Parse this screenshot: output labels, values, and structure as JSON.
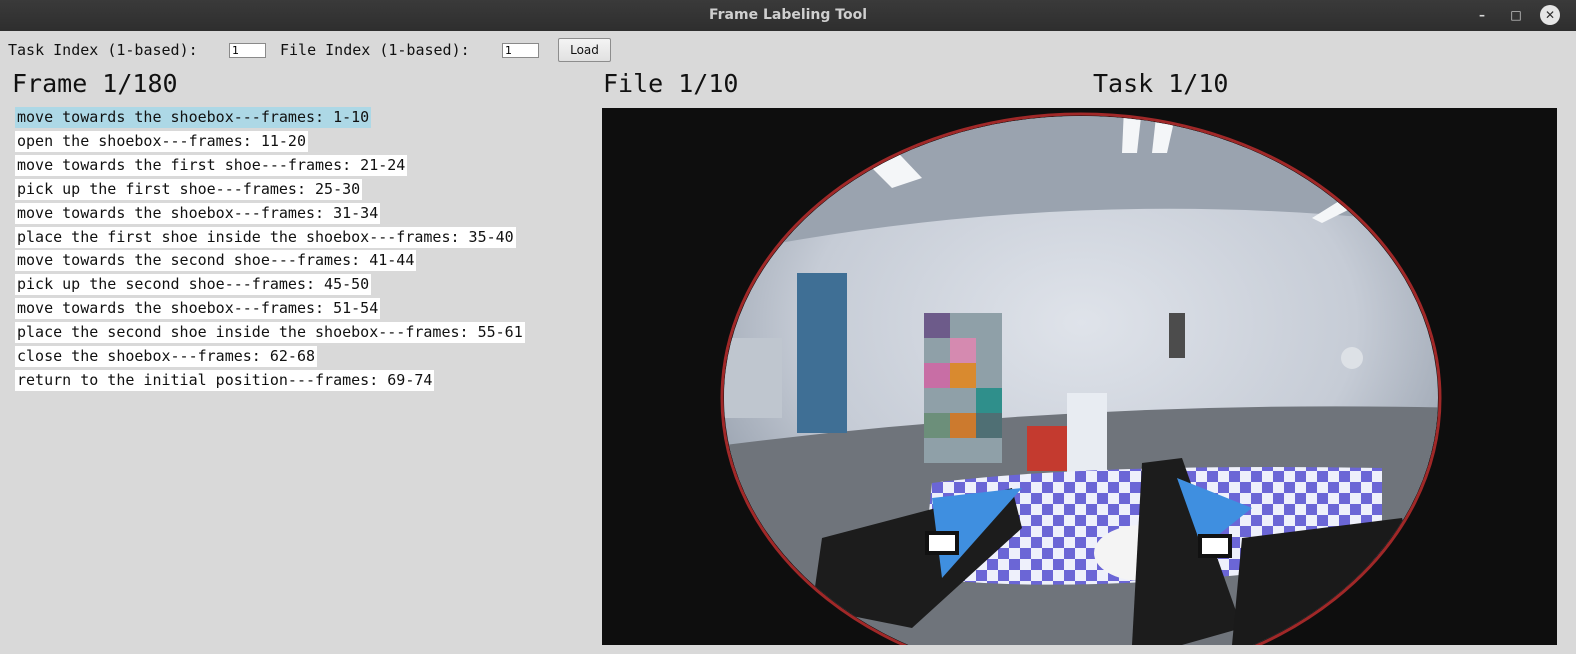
{
  "window": {
    "title": "Frame Labeling Tool"
  },
  "toolbar": {
    "task_index_label": "Task Index (1-based):",
    "task_index_value": "1",
    "file_index_label": "File Index (1-based):",
    "file_index_value": "1",
    "load_label": "Load"
  },
  "headers": {
    "frame": "Frame 1/180",
    "file": "File 1/10",
    "task": "Task 1/10"
  },
  "segments": [
    "move towards the shoebox---frames: 1-10",
    "open the shoebox---frames: 11-20",
    "move towards the first shoe---frames: 21-24",
    "pick up the first shoe---frames: 25-30",
    "move towards the shoebox---frames: 31-34",
    "place the first shoe inside the shoebox---frames: 35-40",
    "move towards the second shoe---frames: 41-44",
    "pick up the second shoe---frames: 45-50",
    "move towards the shoebox---frames: 51-54",
    "place the second shoe inside the shoebox---frames: 55-61",
    "close the shoebox---frames: 62-68",
    "return to the initial position---frames: 69-74"
  ],
  "selected_segment": 0,
  "icons": {
    "minimize": "minimize-icon",
    "maximize": "maximize-icon",
    "close": "close-icon"
  },
  "colors": {
    "selection": "#add8e6",
    "window_bg": "#d9d9d9",
    "titlebar": "#2e2e2e"
  }
}
